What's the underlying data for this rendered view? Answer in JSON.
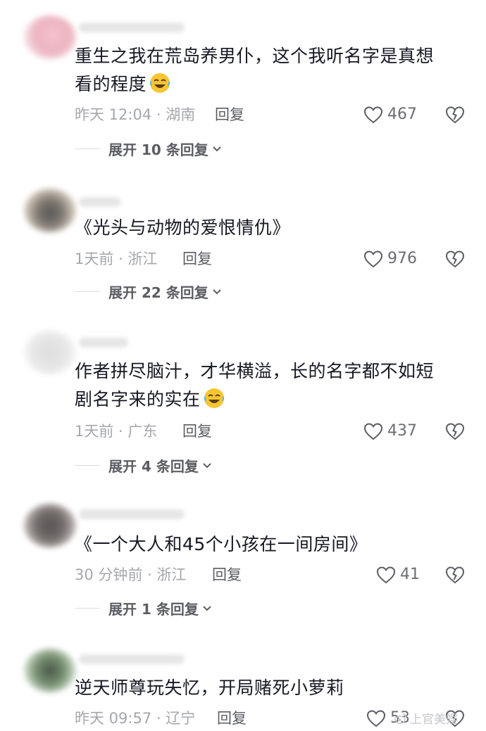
{
  "comments": [
    {
      "text": "重生之我在荒岛养男仆，这个我听名字是真想看的程度",
      "text_line1": "重生之我在荒岛养男仆，这个我听名字是真想",
      "text_line2": "看的程度",
      "emoji": "laughing-crying-emoji",
      "meta": "昨天 12:04 · 湖南",
      "reply_label": "回复",
      "likes": "467",
      "expand_label": "展开 10 条回复"
    },
    {
      "text": "《光头与动物的爱恨情仇》",
      "meta": "1天前 · 浙江",
      "reply_label": "回复",
      "likes": "976",
      "expand_label": "展开 22 条回复"
    },
    {
      "text": "作者拼尽脑汁，才华横溢，长的名字都不如短剧名字来的实在",
      "text_line1": "作者拼尽脑汁，才华横溢，长的名字都不如短",
      "text_line2": "剧名字来的实在",
      "emoji": "laughing-crying-emoji",
      "meta": "1天前 · 广东",
      "reply_label": "回复",
      "likes": "437",
      "expand_label": "展开 4 条回复"
    },
    {
      "text": "《一个大人和45个小孩在一间房间》",
      "meta": "30 分钟前 · 浙江",
      "reply_label": "回复",
      "likes": "41",
      "expand_label": "展开 1 条回复"
    },
    {
      "text": "逆天师尊玩失忆，开局赌死小萝莉",
      "meta": "昨天 09:57 · 辽宁",
      "reply_label": "回复",
      "likes": "53"
    }
  ],
  "watermark": "上官美娱",
  "colors": {
    "text": "#161823",
    "meta": "#a5a7ad",
    "action": "#5b5d63"
  }
}
